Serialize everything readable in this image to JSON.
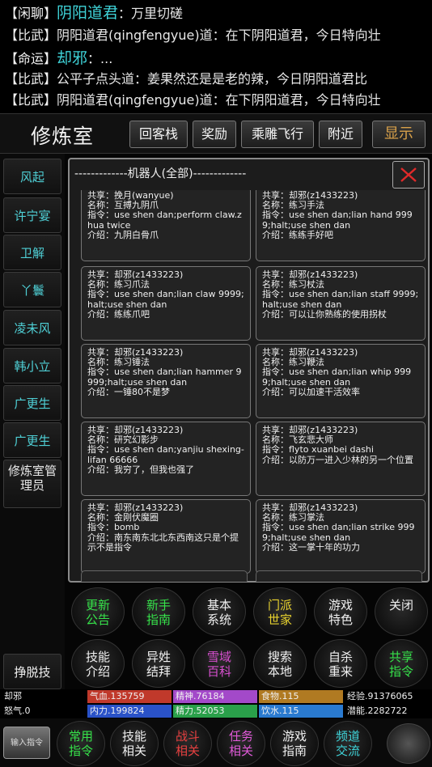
{
  "chat": [
    {
      "channel": "【闲聊】",
      "name": "阴阳道君",
      "sep": "：",
      "text": "万里切磋",
      "big": true
    },
    {
      "channel": "【比武】",
      "name": "",
      "sep": "",
      "text": "阴阳道君(qingfengyue)道：在下阴阳道君，今日特向壮",
      "big": false
    },
    {
      "channel": "【命运】",
      "name": "却邪",
      "sep": "：",
      "text": "...",
      "big": true
    },
    {
      "channel": "【比武】",
      "name": "",
      "sep": "",
      "text": "公平子点头道：姜果然还是是老的辣，今日阴阳道君比",
      "big": false
    },
    {
      "channel": "【比武】",
      "name": "",
      "sep": "",
      "text": "阴阳道君(qingfengyue)道：在下阴阳道君，今日特向壮",
      "big": false
    }
  ],
  "header": {
    "title": "修炼室",
    "buttons": [
      "回客栈",
      "奖励",
      "乘雕飞行",
      "附近"
    ],
    "show_label": "显示"
  },
  "sidebar": {
    "items": [
      "风起",
      "许宁宴",
      "卫解",
      "丫鬟",
      "凌未风",
      "韩小立",
      "广更生",
      "广更生",
      "修炼室管理员"
    ],
    "escape_label": "挣脱技"
  },
  "modal": {
    "title": "-------------机器人(全部)-------------",
    "cards": [
      {
        "share": "共享：挽月(wanyue)",
        "name": "名称：互搏九阴爪",
        "cmd": "指令：use shen dan;perform claw.zhua twice",
        "desc": "介绍：九阴白骨爪"
      },
      {
        "share": "共享：却邪(z1433223)",
        "name": "名称：练习手法",
        "cmd": "指令：use shen dan;lian hand 9999;halt;use shen dan",
        "desc": "介绍：练练手好吧"
      },
      {
        "share": "共享：却邪(z1433223)",
        "name": "名称：练习爪法",
        "cmd": "指令：use shen dan;lian claw 9999;halt;use shen dan",
        "desc": "介绍：练练爪吧"
      },
      {
        "share": "共享：却邪(z1433223)",
        "name": "名称：练习杖法",
        "cmd": "指令：use shen dan;lian staff 9999;halt;use shen dan",
        "desc": "介绍：可以让你熟练的使用拐杖"
      },
      {
        "share": "共享：却邪(z1433223)",
        "name": "名称：练习锤法",
        "cmd": "指令：use shen dan;lian hammer 9999;halt;use shen dan",
        "desc": "介绍：一锤80不是梦"
      },
      {
        "share": "共享：却邪(z1433223)",
        "name": "名称：练习鞭法",
        "cmd": "指令：use shen dan;lian whip 9999;halt;use shen dan",
        "desc": "介绍：可以加速干活效率"
      },
      {
        "share": "共享：却邪(z1433223)",
        "name": "名称：研究幻影步",
        "cmd": "指令：use shen dan;yanjiu shexing-lifan 66666",
        "desc": "介绍：我穷了，但我也强了"
      },
      {
        "share": "共享：却邪(z1433223)",
        "name": "名称：飞玄悲大师",
        "cmd": "指令：flyto xuanbei dashi",
        "desc": "介绍：以防万一进入少林的另一个位置"
      },
      {
        "share": "共享：却邪(z1433223)",
        "name": "名称：金刚伏魔圈",
        "cmd": "指令：bomb",
        "desc": "介绍：南东南东北北东西南这只是个提示不是指令"
      },
      {
        "share": "共享：却邪(z1433223)",
        "name": "名称：练习掌法",
        "cmd": "指令：use shen dan;lian strike 9999;halt;use shen dan",
        "desc": "介绍：这一掌十年的功力"
      }
    ]
  },
  "menu": {
    "row1": [
      {
        "label": "更新公告",
        "color": "green"
      },
      {
        "label": "新手指南",
        "color": "green"
      },
      {
        "label": "基本系统",
        "color": "white"
      },
      {
        "label": "门派世家",
        "color": "yellow"
      },
      {
        "label": "游戏特色",
        "color": "white"
      },
      {
        "label": "关闭",
        "color": "white"
      }
    ],
    "row2": [
      {
        "label": "技能介绍",
        "color": "white"
      },
      {
        "label": "异姓结拜",
        "color": "white"
      },
      {
        "label": "雪域百科",
        "color": "pink"
      },
      {
        "label": "搜索本地",
        "color": "white"
      },
      {
        "label": "自杀重来",
        "color": "white"
      },
      {
        "label": "共享指令",
        "color": "green"
      }
    ]
  },
  "stats": {
    "player": "却邪",
    "qixue": "气血.135759",
    "jingshen": "精神.76184",
    "shiwu": "食物.115",
    "jingyan": "经验.91376065",
    "nuqi": "怒气.0",
    "neili": "内力.199824",
    "jingli": "精力.52053",
    "yinshui": "饮水.115",
    "qianneng": "潜能.2282722",
    "colors": {
      "qixue": "#c0392b",
      "jingshen": "#a349c9",
      "shiwu": "#b07a22",
      "neili": "#2a52c8",
      "jingli": "#2aa04a",
      "yinshui": "#2a7ad0"
    }
  },
  "bottom": {
    "input_label": "输入指令",
    "buttons": [
      {
        "label": "常用指令",
        "color": "green"
      },
      {
        "label": "技能相关",
        "color": "white"
      },
      {
        "label": "战斗相关",
        "color": "red"
      },
      {
        "label": "任务相关",
        "color": "magenta"
      },
      {
        "label": "游戏指南",
        "color": "white"
      },
      {
        "label": "频道交流",
        "color": "cyan"
      }
    ]
  }
}
